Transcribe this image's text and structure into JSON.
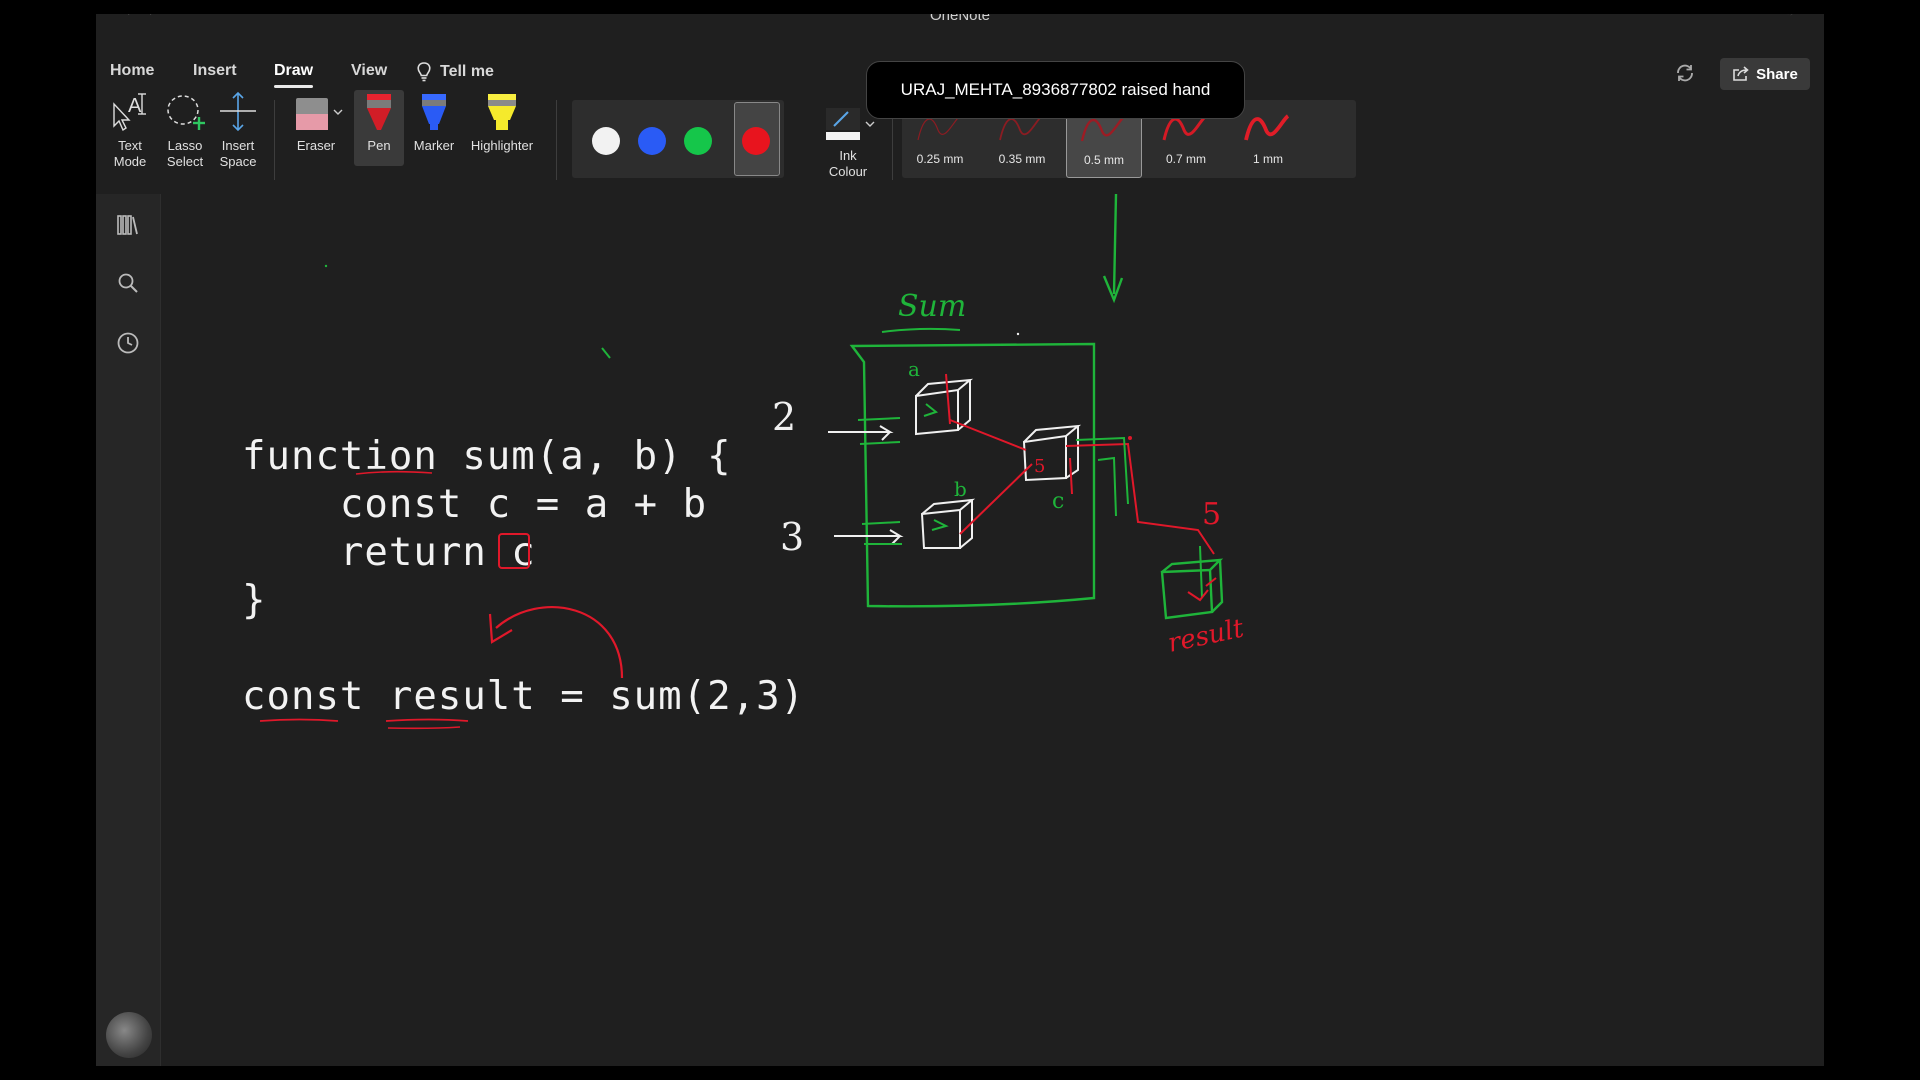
{
  "window": {
    "title": "OneNote"
  },
  "menu": {
    "tabs": [
      {
        "label": "Home"
      },
      {
        "label": "Insert"
      },
      {
        "label": "Draw"
      },
      {
        "label": "View"
      }
    ],
    "tell_me": "Tell me",
    "share": "Share",
    "active_tab": "Draw"
  },
  "toolbar": {
    "text_mode": "Text\nMode",
    "lasso_select": "Lasso\nSelect",
    "insert_space": "Insert\nSpace",
    "eraser": "Eraser",
    "pen": "Pen",
    "marker": "Marker",
    "highlighter": "Highlighter",
    "ink_colour": "Ink\nColour",
    "colors": [
      {
        "name": "white",
        "hex": "#f2f2f2"
      },
      {
        "name": "blue",
        "hex": "#2a5bf5"
      },
      {
        "name": "green",
        "hex": "#15c64a"
      },
      {
        "name": "red",
        "hex": "#e8141e"
      }
    ],
    "selected_color": "red",
    "thicknesses": [
      {
        "label": "0.25 mm"
      },
      {
        "label": "0.35 mm"
      },
      {
        "label": "0.5 mm"
      },
      {
        "label": "0.7 mm"
      },
      {
        "label": "1 mm"
      }
    ],
    "selected_thickness": "0.5 mm"
  },
  "notification": {
    "text": "URAJ_MEHTA_8936877802 raised hand"
  },
  "sidebar": {
    "icons": [
      "notebooks-icon",
      "search-icon",
      "recent-icon"
    ]
  },
  "canvas": {
    "code": [
      "function sum(a, b) {",
      "    const c = a + b",
      "    return c",
      "}",
      "",
      "const result = sum(2,3)"
    ],
    "handwriting": {
      "title": "Sum",
      "input_1": "2",
      "input_2": "3",
      "output": "5",
      "label_a": "a",
      "label_b": "b",
      "label_c": "c",
      "result_label": "result"
    }
  },
  "ink_colors": {
    "white": "#f0f0f0",
    "green": "#1fb43a",
    "red": "#e0182a"
  }
}
